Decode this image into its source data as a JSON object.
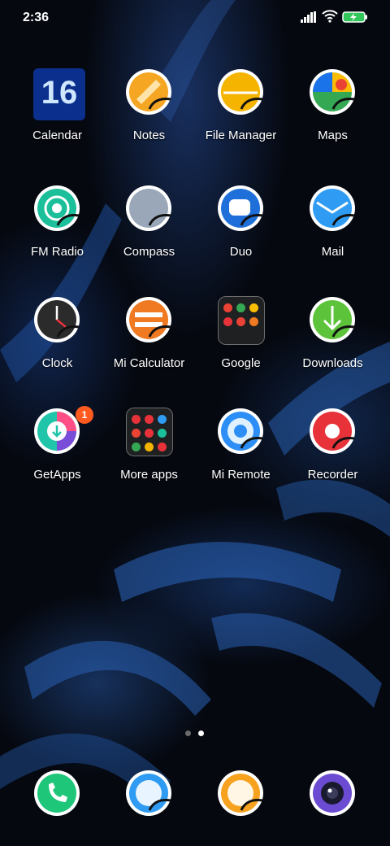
{
  "status_bar": {
    "time": "2:36"
  },
  "colors": {
    "calendar": "#0b2f8c",
    "notes": "#f5a623",
    "file_manager": "#f4b400",
    "maps_green": "#34a853",
    "fm_radio": "#1bbf9a",
    "compass": "#9aa7b8",
    "duo": "#1e6fd9",
    "mail": "#2f9bf2",
    "clock": "#3a3a3a",
    "mi_calculator": "#f07a22",
    "downloads": "#5cc33a",
    "getapps": "#20c4a8",
    "mi_remote": "#2d8ff5",
    "recorder": "#e8323a",
    "badge": "#ff5a1f",
    "dock_phone": "#1ec67a",
    "dock_messages": "#2f9bf2",
    "dock_browser": "#f6a21e",
    "dock_camera": "#6b4bd1"
  },
  "apps": [
    {
      "label": "Calendar",
      "icon": "calendar-icon",
      "day": "16"
    },
    {
      "label": "Notes",
      "icon": "notes-icon"
    },
    {
      "label": "File Manager",
      "icon": "file-manager-icon"
    },
    {
      "label": "Maps",
      "icon": "maps-icon"
    },
    {
      "label": "FM Radio",
      "icon": "fm-radio-icon"
    },
    {
      "label": "Compass",
      "icon": "compass-icon"
    },
    {
      "label": "Duo",
      "icon": "duo-icon"
    },
    {
      "label": "Mail",
      "icon": "mail-icon"
    },
    {
      "label": "Clock",
      "icon": "clock-icon"
    },
    {
      "label": "Mi Calculator",
      "icon": "calculator-icon"
    },
    {
      "label": "Google",
      "icon": "google-folder-icon"
    },
    {
      "label": "Downloads",
      "icon": "downloads-icon"
    },
    {
      "label": "GetApps",
      "icon": "getapps-icon",
      "badge": "1"
    },
    {
      "label": "More apps",
      "icon": "more-apps-folder-icon"
    },
    {
      "label": "Mi Remote",
      "icon": "mi-remote-icon"
    },
    {
      "label": "Recorder",
      "icon": "recorder-icon"
    }
  ],
  "page_indicator": {
    "pages": 2,
    "current": 2
  },
  "dock": [
    {
      "icon": "phone-icon"
    },
    {
      "icon": "messages-icon"
    },
    {
      "icon": "browser-icon"
    },
    {
      "icon": "camera-icon"
    }
  ]
}
